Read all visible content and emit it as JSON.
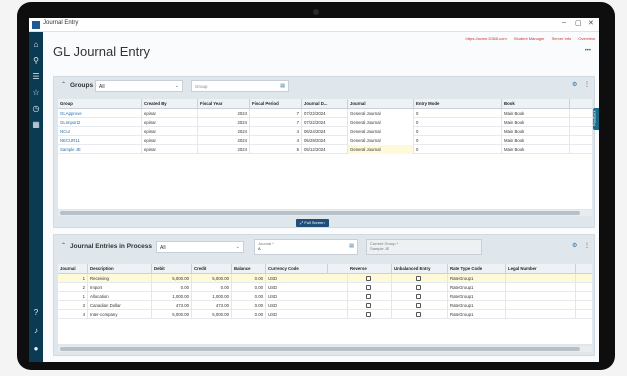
{
  "window": {
    "title": "Journal Entry",
    "minimize": "–",
    "maximize": "▢",
    "close": "✕"
  },
  "header_links": [
    "https://acme.D365.com",
    "Student Manager",
    "Server Info",
    "Overview"
  ],
  "page": {
    "title": "GL Journal Entry",
    "more": "•••"
  },
  "sidebar": {
    "icons": [
      "home-icon",
      "search-icon",
      "list-icon",
      "star-icon",
      "recent-icon",
      "grid-icon",
      "help-icon",
      "bell-icon",
      "user-icon"
    ],
    "glyphs": [
      "⌂",
      "⚲",
      "☰",
      "☆",
      "◷",
      "▦",
      "?",
      "♪",
      "●"
    ]
  },
  "groups_panel": {
    "title": "Groups",
    "filter": "All",
    "search_placeholder": "Group",
    "settings_icon": "⚙",
    "more_icon": "⋮",
    "columns": [
      "Group",
      "Created By",
      "Fiscal Year",
      "Fiscal Period",
      "Journal D...",
      "Journal",
      "Entry Mode",
      "Book"
    ],
    "rows": [
      [
        "GLApprove",
        "epinar",
        "2024",
        "7",
        "07/22/2024",
        "General Journal",
        "0",
        "Main Book"
      ],
      [
        "GLImport2",
        "epinar",
        "2024",
        "7",
        "07/22/2024",
        "General Journal",
        "0",
        "Main Book"
      ],
      [
        "NCur",
        "epinar",
        "2024",
        "4",
        "06/24/2024",
        "General Journal",
        "0",
        "Main Book"
      ],
      [
        "NECUR11",
        "epinar",
        "2024",
        "4",
        "05/29/2024",
        "General Journal",
        "0",
        "Main Book"
      ],
      [
        "Sample JE",
        "epinar",
        "2024",
        "5",
        "05/12/2024",
        "General Journal",
        "0",
        "Main Book"
      ]
    ],
    "full_screen_label": "Full Screen"
  },
  "entries_panel": {
    "title": "Journal Entries in Process",
    "filter": "All",
    "journal_label": "Journal *",
    "journal_value": "A",
    "current_group_label": "Current Group *",
    "current_group_value": "Sample JE",
    "columns": [
      "Journal",
      "Description",
      "Debit",
      "Credit",
      "Balance",
      "Currency Code",
      "Reverse",
      "Unbalanced Entry",
      "Rate Type Code",
      "Legal Number"
    ],
    "rows": [
      {
        "journal": "1",
        "description": "Receiving",
        "debit": "5,000.00",
        "credit": "5,000.00",
        "balance": "0.00",
        "currency": "USD",
        "rate": "RateGroup1"
      },
      {
        "journal": "2",
        "description": "Import",
        "debit": "0.00",
        "credit": "0.00",
        "balance": "0.00",
        "currency": "USD",
        "rate": "RateGroup1"
      },
      {
        "journal": "1",
        "description": "Allocation",
        "debit": "1,000.00",
        "credit": "1,000.00",
        "balance": "0.00",
        "currency": "USD",
        "rate": "RateGroup1"
      },
      {
        "journal": "3",
        "description": "Canadian Dollar",
        "debit": "473.00",
        "credit": "473.00",
        "balance": "0.00",
        "currency": "USD",
        "rate": "RateGroup1"
      },
      {
        "journal": "4",
        "description": "Inter-company",
        "debit": "5,000.00",
        "credit": "5,000.00",
        "balance": "0.00",
        "currency": "USD",
        "rate": "RateGroup1"
      }
    ]
  },
  "feedback_label": "Feedback"
}
